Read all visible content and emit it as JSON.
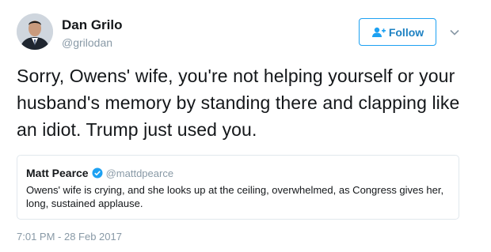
{
  "author": {
    "name": "Dan Grilo",
    "handle": "@grilodan"
  },
  "follow_button": {
    "label": "Follow",
    "icon": "add-user-icon"
  },
  "menu": {
    "icon": "chevron-down-icon"
  },
  "tweet": {
    "text": "Sorry, Owens' wife, you're not helping yourself or your husband's memory by standing there and clapping like an idiot. Trump just used you."
  },
  "quoted_tweet": {
    "name": "Matt Pearce",
    "verified_icon": "verified-badge-icon",
    "handle": "@mattdpearce",
    "text": "Owens' wife is crying, and she looks up at the ceiling, overwhelmed, as Congress gives her, long, sustained applause."
  },
  "timestamp": "7:01 PM - 28 Feb 2017",
  "colors": {
    "accent": "#1da1f2",
    "text": "#14171a",
    "secondary": "#8899a6",
    "border": "#e1e8ed"
  }
}
